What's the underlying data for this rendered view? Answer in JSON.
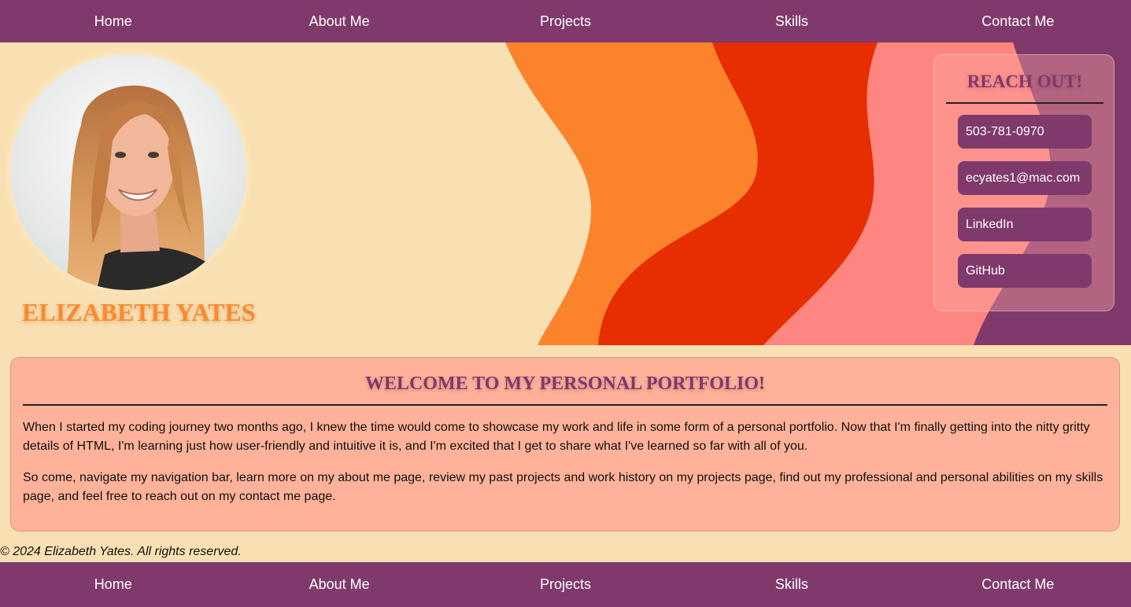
{
  "nav": {
    "items": [
      "Home",
      "About Me",
      "Projects",
      "Skills",
      "Contact Me"
    ]
  },
  "hero": {
    "name": "ELIZABETH YATES"
  },
  "contact_card": {
    "title": "REACH OUT!",
    "phone": "503-781-0970",
    "email": "ecyates1@mac.com",
    "linkedin": "LinkedIn",
    "github": "GitHub"
  },
  "welcome": {
    "title": "WELCOME TO MY PERSONAL PORTFOLIO!",
    "paragraphs": [
      "When I started my coding journey two months ago, I knew the time would come to showcase my work and life in some form of a personal portfolio. Now that I'm finally getting into the nitty gritty details of HTML, I'm learning just how user-friendly and intuitive it is, and I'm excited that I get to share what I've learned so far with all of you.",
      "So come, navigate my navigation bar, learn more on my about me page, review my past projects and work history on my projects page, find out my professional and personal abilities on my skills page, and feel free to reach out on my contact me page."
    ]
  },
  "footer": {
    "copyright": "© 2024 Elizabeth Yates. All rights reserved."
  },
  "colors": {
    "nav_bg": "#7f3a6b",
    "page_bg": "#f9e0b3",
    "wave_orange": "#fb832c",
    "wave_red": "#e62e00",
    "wave_pink": "#fe8680",
    "wave_plum": "#7f3a6b",
    "name_color": "#fb8a2e",
    "card_bg": "#ffb29a"
  }
}
